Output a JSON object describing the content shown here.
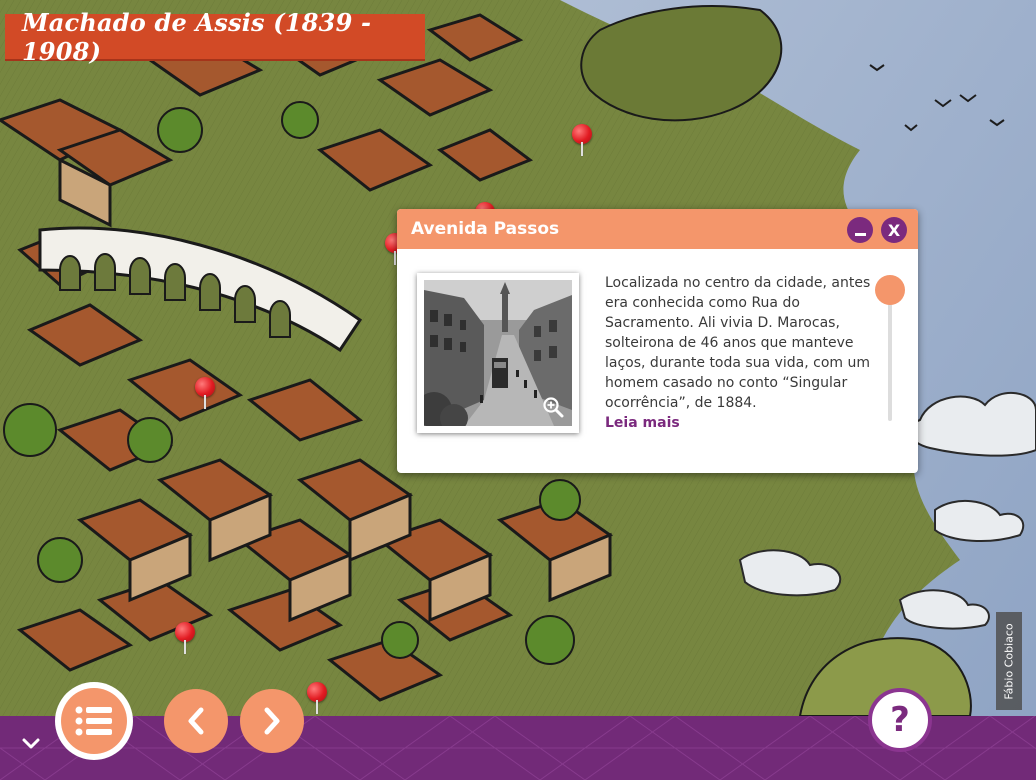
{
  "app": {
    "title": "Machado de Assis (1839 - 1908)"
  },
  "popup": {
    "title": "Avenida Passos",
    "minimize_icon": "minimize-icon",
    "close_label": "X",
    "description": "Localizada no centro da cidade, antes era conhecida como Rua do Sacramento. Ali vivia D. Marocas, solteirona de 46 anos que manteve laços, durante toda sua vida, com um homem casado no conto “Singular ocorrência”, de 1884.",
    "read_more": "Leia mais",
    "photo_zoom_icon": "zoom-in-icon"
  },
  "credit": "Fábio Cobiaco",
  "toolbar": {
    "menu_icon": "list-icon",
    "prev_icon": "chevron-left-icon",
    "next_icon": "chevron-right-icon",
    "help_label": "?",
    "collapse_icon": "chevron-down-icon"
  },
  "colors": {
    "accent": "#f4966b",
    "brand_purple": "#722a78",
    "title_red": "#d24a26",
    "pin_red": "#e21b22"
  }
}
